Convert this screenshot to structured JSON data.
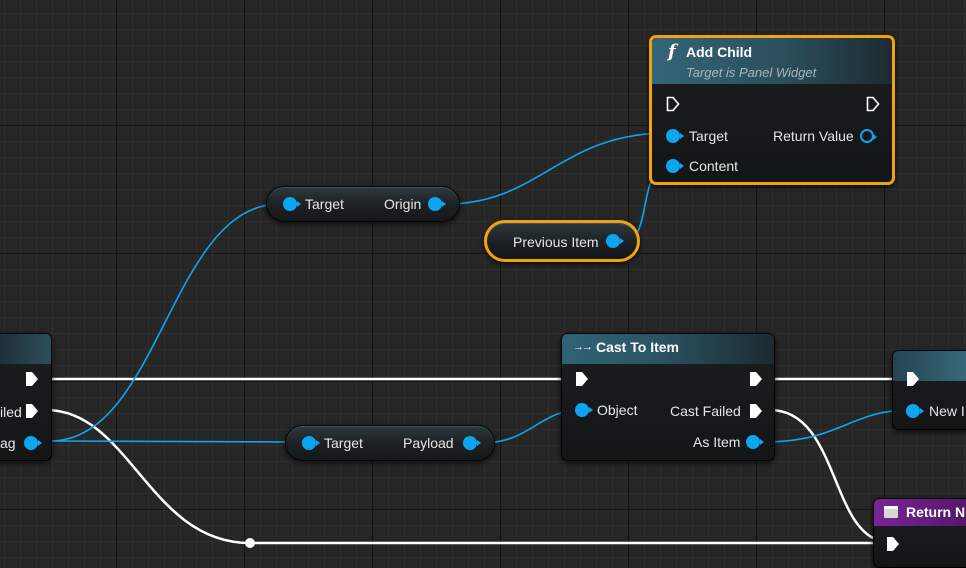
{
  "nodes": {
    "add_child": {
      "title": "Add Child",
      "func_glyph": "f",
      "subtitle": "Target is Panel Widget",
      "pins": {
        "target": "Target",
        "content": "Content",
        "return_value": "Return Value"
      }
    },
    "cast_to_item": {
      "title": "Cast To Item",
      "title_glyph": "→→",
      "pins": {
        "object": "Object",
        "cast_failed": "Cast Failed",
        "as_item": "As Item"
      }
    },
    "origin_get": {
      "target": "Target",
      "output": "Origin"
    },
    "previous_item": {
      "label": "Previous Item"
    },
    "payload_get": {
      "target": "Target",
      "output": "Payload"
    },
    "left_partial": {
      "pin_failed": "iled",
      "pin_tag": "ag"
    },
    "right_partial": {
      "pin_new": "New I"
    },
    "return_node": {
      "title": "Return N"
    }
  },
  "colors": {
    "graph_background": "#262626",
    "exec_wire": "#ffffff",
    "object_wire": "#0ea5f0",
    "selection_outline": "#f2a20c",
    "function_header": "#356577",
    "return_header": "#6d1e87"
  },
  "icons": {
    "func": "function-icon",
    "cast": "cast-arrows-icon",
    "return": "return-node-icon",
    "exec": "exec-pin-icon"
  }
}
